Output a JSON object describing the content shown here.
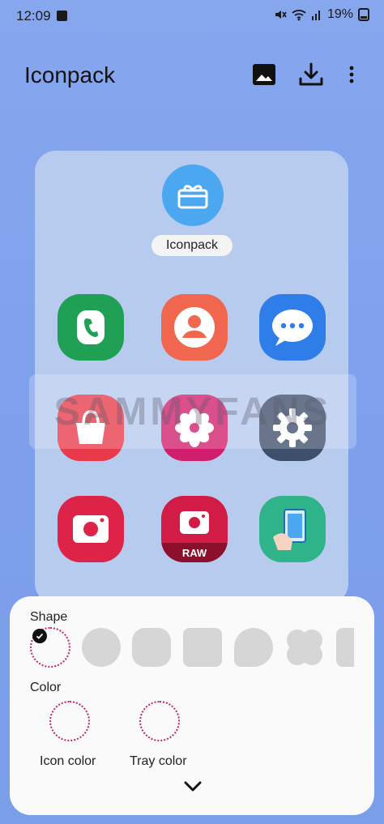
{
  "status_bar": {
    "time": "12:09",
    "battery": "19%"
  },
  "header": {
    "title": "Iconpack"
  },
  "preview": {
    "main_label": "Iconpack",
    "watermark": "SAMMYFANS",
    "raw_badge": "RAW"
  },
  "sheet": {
    "shape_label": "Shape",
    "color_label": "Color",
    "icon_color_label": "Icon color",
    "tray_color_label": "Tray color"
  },
  "colors": {
    "background": "#7ea0ec",
    "card": "#b7cbef",
    "accent_dotted": "#c8245e",
    "phone": "#1fa055",
    "contacts": "#f0664e",
    "messages": "#2f7de8",
    "store": "#e83a4a",
    "flower": "#d01e6c",
    "settings": "#3e4f6b",
    "camera": "#dd2347",
    "raw_camera": "#d21b45",
    "screen_app": "#2fb489"
  }
}
